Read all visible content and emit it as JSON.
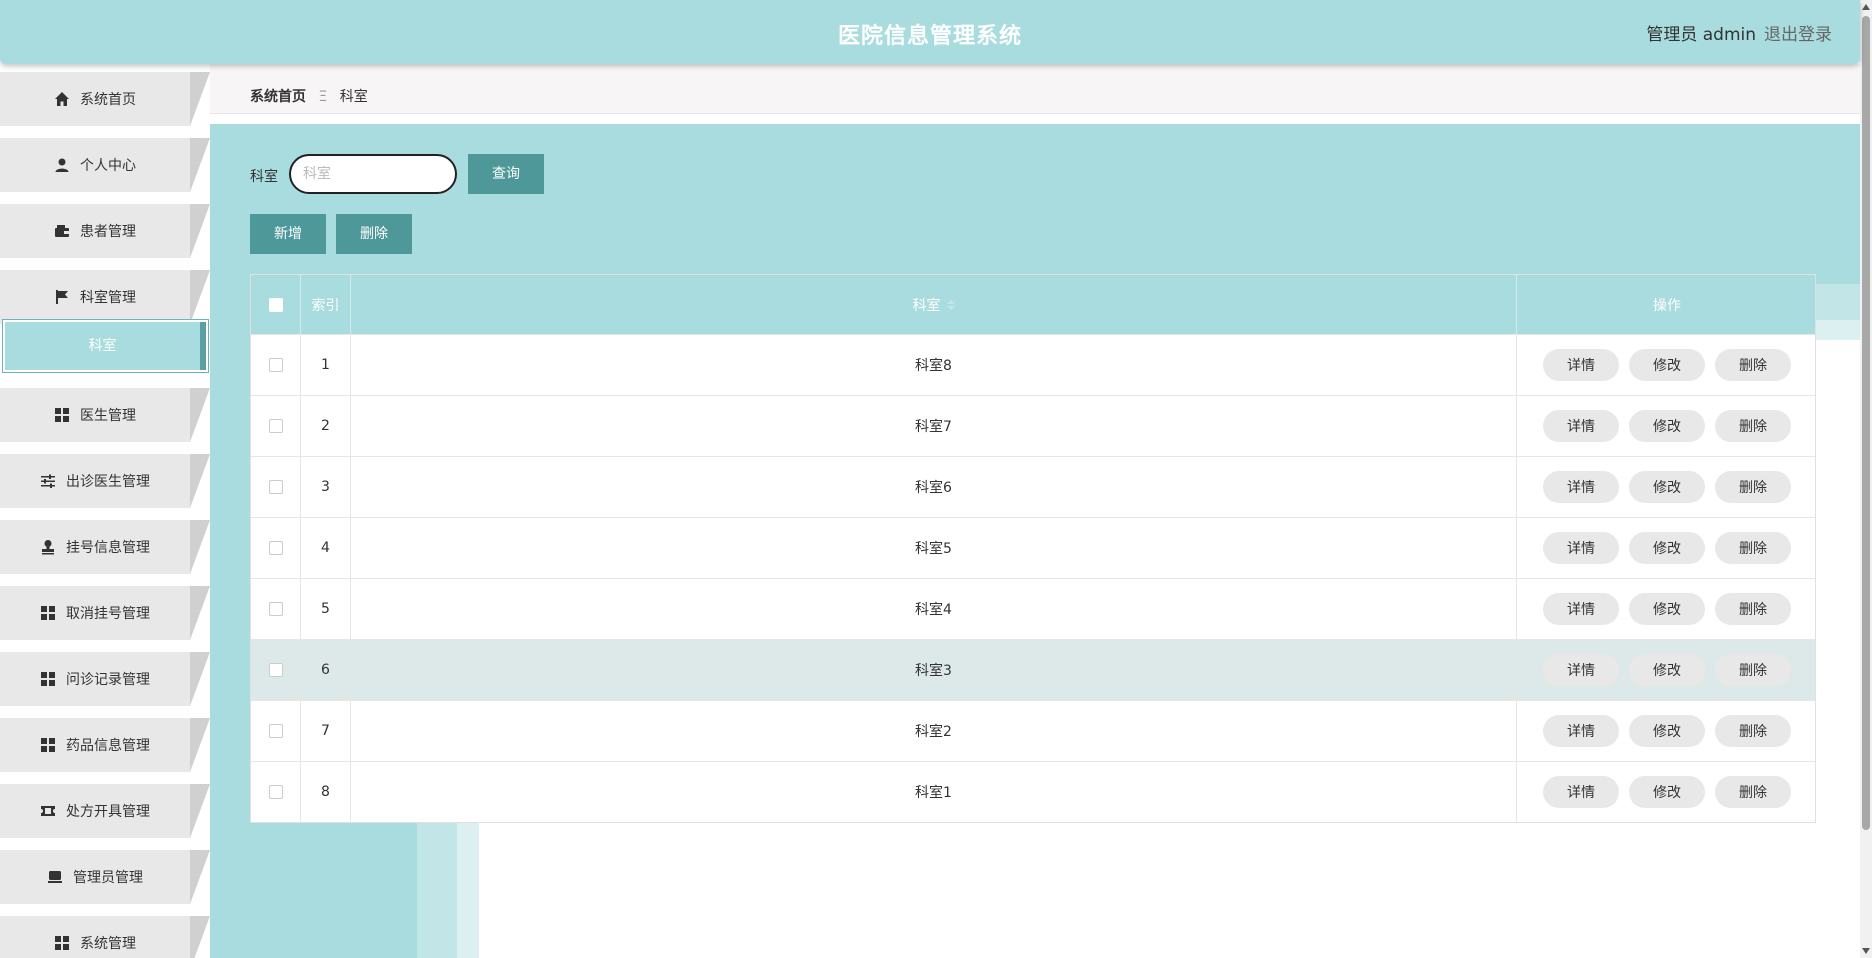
{
  "header": {
    "title": "医院信息管理系统",
    "user": "管理员 admin",
    "logout": "退出登录"
  },
  "sidebar": {
    "items": [
      {
        "label": "系统首页",
        "icon": "home-icon"
      },
      {
        "label": "个人中心",
        "icon": "user-icon"
      },
      {
        "label": "患者管理",
        "icon": "wallet-icon"
      },
      {
        "label": "科室管理",
        "icon": "flag-icon"
      },
      {
        "label": "医生管理",
        "icon": "grid-icon"
      },
      {
        "label": "出诊医生管理",
        "icon": "sliders-icon"
      },
      {
        "label": "挂号信息管理",
        "icon": "stamp-icon"
      },
      {
        "label": "取消挂号管理",
        "icon": "grid-icon"
      },
      {
        "label": "问诊记录管理",
        "icon": "grid-icon"
      },
      {
        "label": "药品信息管理",
        "icon": "grid-icon"
      },
      {
        "label": "处方开具管理",
        "icon": "ticket-icon"
      },
      {
        "label": "管理员管理",
        "icon": "monitor-icon"
      },
      {
        "label": "系统管理",
        "icon": "grid-icon"
      }
    ],
    "active_sub": "科室"
  },
  "breadcrumb": {
    "home": "系统首页",
    "separator": "Ξ",
    "current": "科室"
  },
  "search": {
    "label": "科室",
    "placeholder": "科室",
    "value": "",
    "query_button": "查询"
  },
  "actions": {
    "add": "新增",
    "delete": "删除"
  },
  "table": {
    "columns": {
      "index": "索引",
      "name": "科室",
      "ops": "操作"
    },
    "row_buttons": {
      "detail": "详情",
      "edit": "修改",
      "delete": "删除"
    },
    "rows": [
      {
        "index": "1",
        "name": "科室8"
      },
      {
        "index": "2",
        "name": "科室7"
      },
      {
        "index": "3",
        "name": "科室6"
      },
      {
        "index": "4",
        "name": "科室5"
      },
      {
        "index": "5",
        "name": "科室4"
      },
      {
        "index": "6",
        "name": "科室3"
      },
      {
        "index": "7",
        "name": "科室2"
      },
      {
        "index": "8",
        "name": "科室1"
      }
    ]
  },
  "colors": {
    "accent": "#a8dcde",
    "button": "#4e9899",
    "row_hover": "#dde9e9"
  }
}
